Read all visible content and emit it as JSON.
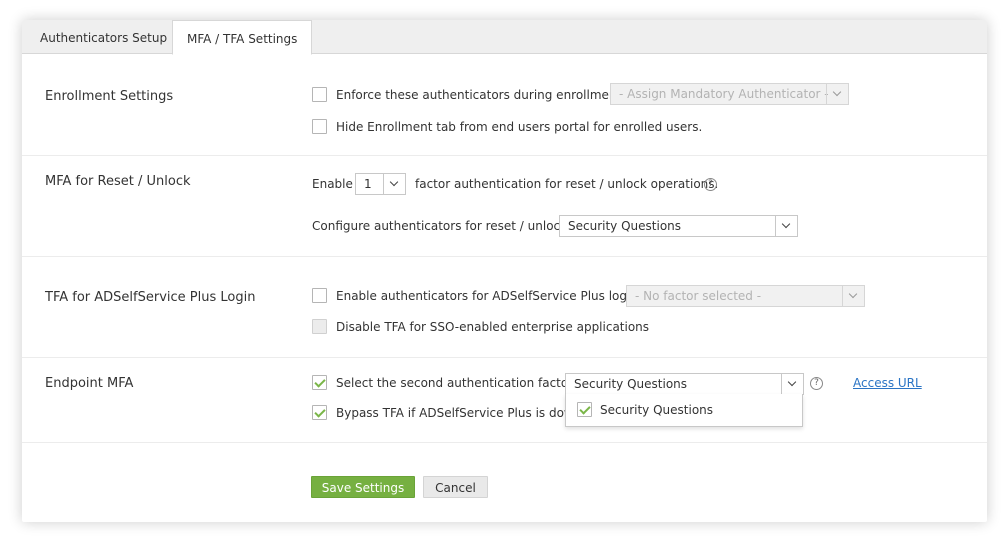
{
  "tabs": {
    "authenticators_setup": "Authenticators Setup",
    "mfa_tfa_settings": "MFA / TFA Settings"
  },
  "enrollment": {
    "label": "Enrollment Settings",
    "enforce_label": "Enforce these authenticators during enrollment",
    "enforce_checked": false,
    "assign_placeholder": "- Assign Mandatory Authenticator -",
    "hide_tab_label": "Hide Enrollment tab from end users portal for enrolled users.",
    "hide_tab_checked": false
  },
  "mfa_reset": {
    "label": "MFA for Reset / Unlock",
    "enable_prefix": "Enable",
    "factor_count": "1",
    "enable_suffix": "factor authentication for reset / unlock operations.",
    "configure_label": "Configure authenticators for reset / unlock",
    "configure_value": "Security Questions"
  },
  "tfa_login": {
    "label": "TFA for ADSelfService Plus Login",
    "enable_label": "Enable authenticators for ADSelfService Plus login",
    "enable_checked": false,
    "factor_placeholder": "- No factor selected -",
    "disable_sso_label": "Disable TFA for SSO-enabled enterprise applications",
    "disable_sso_checked": false
  },
  "endpoint": {
    "label": "Endpoint MFA",
    "second_factor_label": "Select the second authentication factor",
    "second_factor_checked": true,
    "second_factor_value": "Security Questions",
    "access_url": "Access URL",
    "bypass_label": "Bypass TFA if ADSelfService Plus is down",
    "bypass_checked": true,
    "dropdown_option": "Security Questions",
    "dropdown_option_checked": true
  },
  "actions": {
    "save": "Save Settings",
    "cancel": "Cancel"
  },
  "colors": {
    "accent_green": "#76b041",
    "link_blue": "#2a74c5"
  },
  "icons": {
    "help": "question-circle-icon",
    "dropdown": "chevron-down-icon",
    "check": "checkmark-icon"
  }
}
